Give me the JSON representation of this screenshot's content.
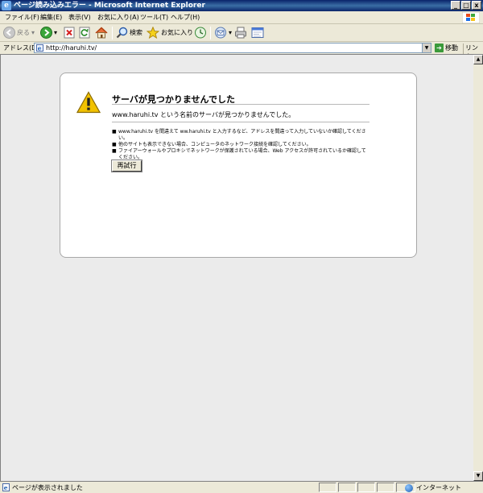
{
  "window": {
    "title": "ページ読み込みエラー - Microsoft Internet Explorer",
    "minimize_glyph": "_",
    "maximize_glyph": "□",
    "close_glyph": "x"
  },
  "menu": {
    "items": [
      "ファイル(F)",
      "編集(E)",
      "表示(V)",
      "お気に入り(A)",
      "ツール(T)",
      "ヘルプ(H)"
    ]
  },
  "toolbar": {
    "back_label": "戻る",
    "search_label": "検索",
    "favorites_label": "お気に入り"
  },
  "address": {
    "label": "アドレス(D)",
    "url": "http://haruhi.tv/",
    "go_label": "移動",
    "links_label": "リンク"
  },
  "error_page": {
    "title": "サーバが見つかりませんでした",
    "message": "www.haruhi.tv という名前のサーバが見つかりませんでした。",
    "tips": [
      "www.haruhi.tv を間違えて ww.haruhi.tv と入力するなど、アドレスを間違って入力していないか確認してください。",
      "他のサイトも表示できない場合、コンピュータのネットワーク接続を確認してください。",
      "ファイアーウォールやプロキシでネットワークが保護されている場合、Web アクセスが許可されているか確認してください。"
    ],
    "tip_bullet": "■",
    "retry_label": "再試行"
  },
  "status": {
    "text": "ページが表示されました",
    "zone": "インターネット"
  },
  "icons": {
    "warning": "warning-triangle-icon",
    "ie": "ie-logo-icon"
  },
  "colors": {
    "titlebar": "#0a246a",
    "warning": "#f2c200",
    "page_bg": "#ebebeb"
  }
}
